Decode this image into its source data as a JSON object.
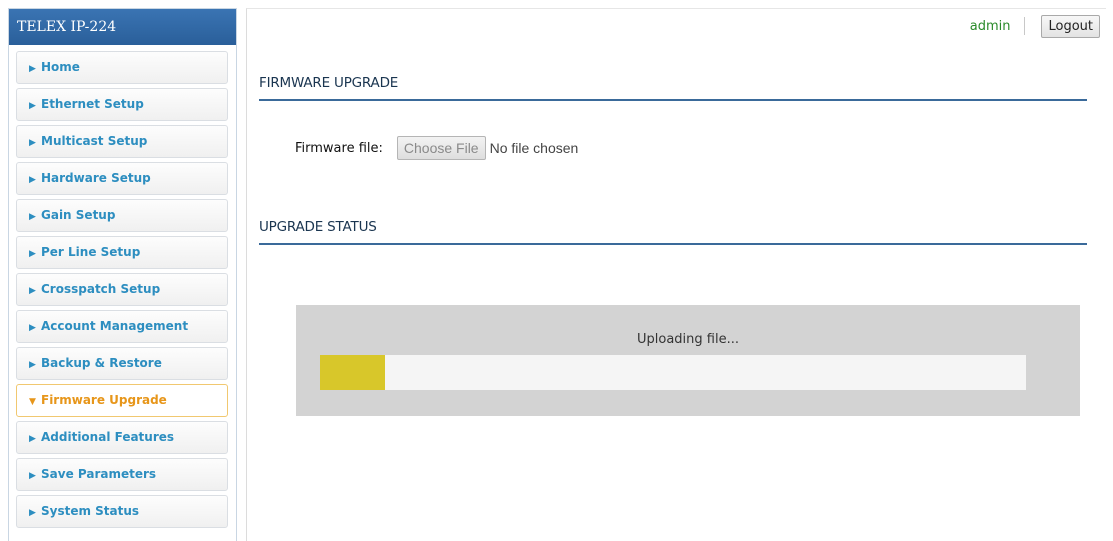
{
  "sidebar": {
    "title": "TELEX IP-224",
    "items": [
      {
        "label": "Home",
        "active": false
      },
      {
        "label": "Ethernet Setup",
        "active": false
      },
      {
        "label": "Multicast Setup",
        "active": false
      },
      {
        "label": "Hardware Setup",
        "active": false
      },
      {
        "label": "Gain Setup",
        "active": false
      },
      {
        "label": "Per Line Setup",
        "active": false
      },
      {
        "label": "Crosspatch Setup",
        "active": false
      },
      {
        "label": "Account Management",
        "active": false
      },
      {
        "label": "Backup & Restore",
        "active": false
      },
      {
        "label": "Firmware Upgrade",
        "active": true
      },
      {
        "label": "Additional Features",
        "active": false
      },
      {
        "label": "Save Parameters",
        "active": false
      },
      {
        "label": "System Status",
        "active": false
      }
    ]
  },
  "header": {
    "username": "admin",
    "logout_label": "Logout"
  },
  "firmware": {
    "section_title": "FIRMWARE UPGRADE",
    "file_label": "Firmware file:",
    "choose_button": "Choose File",
    "no_file_text": "No file chosen"
  },
  "status": {
    "section_title": "UPGRADE STATUS",
    "message": "Uploading file...",
    "progress_percent": 9.2
  },
  "colors": {
    "sidebar_header": "#2f67a3",
    "menu_text": "#2d8ec0",
    "active_text": "#e7961a",
    "progress_fill": "#d8c72a"
  }
}
